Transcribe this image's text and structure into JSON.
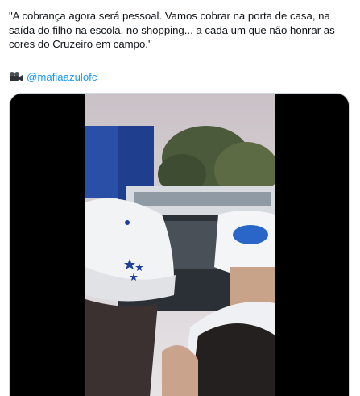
{
  "tweet": {
    "text": "\"A cobrança agora será pessoal. Vamos cobrar na porta de casa, na saída do filho na escola, no shopping... a cada um que não honrar as cores do Cruzeiro em campo.\"",
    "credit_icon": "movie-camera-icon",
    "credit_handle": "@mafiaazulofc"
  },
  "media": {
    "type": "video",
    "background": "#000000",
    "accent_colors": [
      "#1e4fa8",
      "#ffffff"
    ]
  }
}
